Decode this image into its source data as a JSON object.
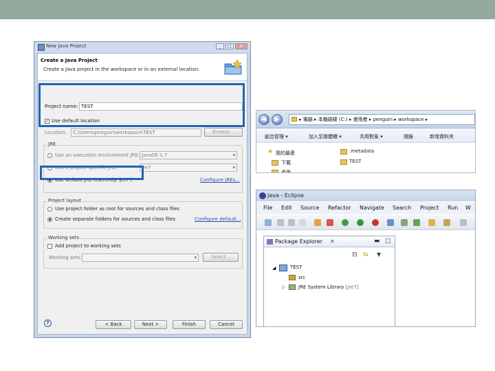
{
  "colors": {
    "highlight": "#1f62b4",
    "topbar": "#95a89e"
  },
  "dialog": {
    "title": "New Java Project",
    "header_title": "Create a Java Project",
    "header_desc": "Create a Java project in the workspace or in an external location.",
    "project_name_label": "Project name:",
    "project_name_value": "TEST",
    "use_default_location_label": "Use default location",
    "use_default_location_checked": true,
    "location_label": "Location:",
    "location_value": "C:\\Users\\penguin\\workspace\\TEST",
    "browse_label": "Browse...",
    "jre": {
      "group_title": "JRE",
      "exec_env_label": "Use an execution environment JRE:",
      "exec_env_value": "JavaSE-1.7",
      "project_specific_label": "Use a project specific JRE:",
      "project_specific_value": "jre7",
      "default_label": "Use default JRE (currently 'jre7')",
      "configure_link": "Configure JREs..."
    },
    "layout": {
      "group_title": "Project layout",
      "single_folder_label": "Use project folder as root for sources and class files",
      "separate_label": "Create separate folders for sources and class files",
      "configure_link": "Configure default..."
    },
    "working_sets": {
      "group_title": "Working sets",
      "add_label": "Add project to working sets",
      "working_sets_label": "Working sets:",
      "select_label": "Select..."
    },
    "help_icon": "?",
    "back_label": "< Back",
    "next_label": "Next >",
    "finish_label": "Finish",
    "cancel_label": "Cancel"
  },
  "explorer": {
    "back_icon": "back-arrow-icon",
    "forward_icon": "forward-arrow-icon",
    "breadcrumb": "▸ 電腦 ▸ 本機磁碟 (C:) ▸ 使用者 ▸ penguin ▸ workspace ▸",
    "toolbar": [
      "組合管理 ▾",
      "加入至媒體櫃 ▾",
      "共用對象 ▾",
      "燒錄",
      "新增資料夾"
    ],
    "favorites": [
      "我的最愛",
      "下載",
      "桌面"
    ],
    "files": [
      ".metadata",
      "TEST"
    ]
  },
  "eclipse": {
    "title": "Java - Eclipse",
    "menu": [
      "File",
      "Edit",
      "Source",
      "Refactor",
      "Navigate",
      "Search",
      "Project",
      "Run",
      "W"
    ],
    "view_title": "Package Explorer",
    "view_close": "✕",
    "tree": {
      "project": "TEST",
      "src": "src",
      "jre_library": "JRE System Library",
      "jre_version": "[jre7]"
    }
  }
}
